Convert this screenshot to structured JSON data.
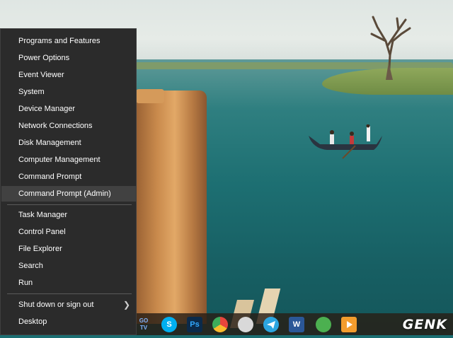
{
  "menu": {
    "group1": [
      {
        "label": "Programs and Features"
      },
      {
        "label": "Power Options"
      },
      {
        "label": "Event Viewer"
      },
      {
        "label": "System"
      },
      {
        "label": "Device Manager"
      },
      {
        "label": "Network Connections"
      },
      {
        "label": "Disk Management"
      },
      {
        "label": "Computer Management"
      },
      {
        "label": "Command Prompt"
      },
      {
        "label": "Command Prompt (Admin)"
      }
    ],
    "group2": [
      {
        "label": "Task Manager"
      },
      {
        "label": "Control Panel"
      },
      {
        "label": "File Explorer"
      },
      {
        "label": "Search"
      },
      {
        "label": "Run"
      }
    ],
    "group3": [
      {
        "label": "Shut down or sign out"
      },
      {
        "label": "Desktop"
      }
    ],
    "highlighted_item": "Command Prompt (Admin)"
  },
  "taskbar": {
    "icons": [
      {
        "name": "go-tv",
        "label": "GO TV",
        "color": "#3a7bd5"
      },
      {
        "name": "skype",
        "label": "S",
        "color": "#00aff0"
      },
      {
        "name": "photoshop",
        "label": "Ps",
        "color": "#0b2a4a"
      },
      {
        "name": "chrome",
        "label": "",
        "color": "#e8453c"
      },
      {
        "name": "paint",
        "label": "",
        "color": "#d9d9d9"
      },
      {
        "name": "telegram",
        "label": "",
        "color": "#2ca5e0"
      },
      {
        "name": "word",
        "label": "W",
        "color": "#2b5797"
      },
      {
        "name": "messenger",
        "label": "",
        "color": "#4cb050"
      },
      {
        "name": "media-player",
        "label": "",
        "color": "#f39c2d"
      }
    ]
  },
  "watermark": "GENK",
  "colors": {
    "menu_background": "#2b2b2b",
    "menu_highlight": "#414141",
    "menu_text": "#ffffff"
  }
}
